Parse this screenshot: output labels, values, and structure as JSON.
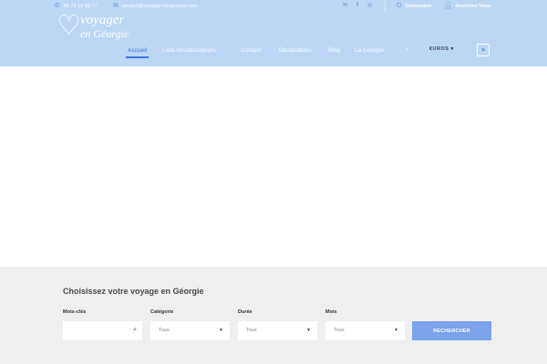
{
  "topbar": {
    "phone": "06 72 15 88 77",
    "email": "contact@voyager-en-georgie.com",
    "social_icons": [
      "envelope-icon",
      "facebook-icon",
      "instagram-icon"
    ],
    "login": "Connexion",
    "register": "Inscrivez-Vous"
  },
  "logo": {
    "line1": "voyager",
    "line2": "en Géorgie"
  },
  "nav": {
    "items": [
      {
        "label": "Accueil",
        "active": true
      },
      {
        "label": "Liste circuits/séjours",
        "has_dropdown": true
      },
      {
        "label": "Contact"
      },
      {
        "label": "Destinations"
      },
      {
        "label": "Blog"
      },
      {
        "label": "La Géorgie",
        "has_dropdown": true
      }
    ],
    "currency": "€UROS",
    "currency_caret": "▾"
  },
  "search": {
    "title": "Choisissez votre voyage en Géorgie",
    "keywords_label": "Mots-clés",
    "keywords_value": "",
    "category_label": "Catégorie",
    "category_value": "Tous",
    "duration_label": "Durée",
    "duration_value": "Tous",
    "month_label": "Mois",
    "month_value": "Tous",
    "button_label": "RECHERCHER"
  },
  "colors": {
    "header_bg": "#bdd6f6",
    "accent": "#3c76d6",
    "button_bg": "#7aa3ea",
    "search_bg": "#efefef"
  }
}
